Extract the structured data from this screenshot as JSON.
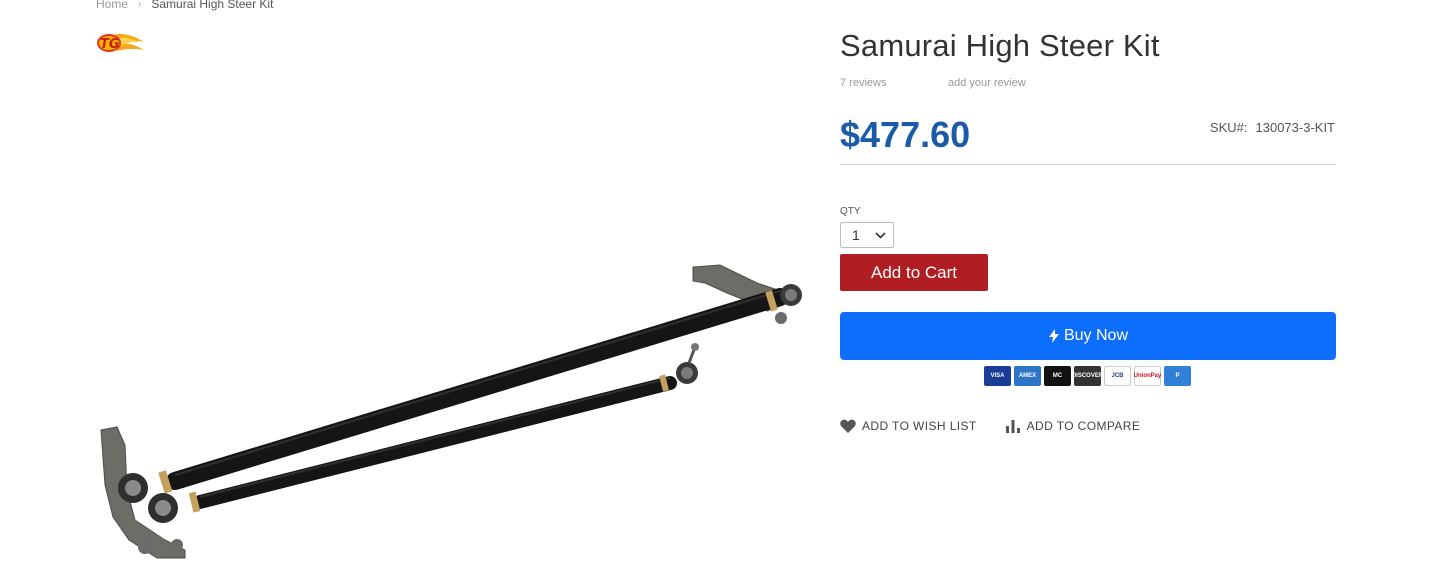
{
  "breadcrumb": {
    "home": "Home",
    "separator": "›",
    "current": "Samurai High Steer Kit"
  },
  "brand": {
    "logo_text": "TG"
  },
  "product": {
    "title": "Samurai High Steer Kit",
    "reviews": "7 reviews",
    "add_review": "add your review",
    "price": "$477.60",
    "sku_label": "SKU#:",
    "sku_value": "130073-3-KIT"
  },
  "purchase": {
    "qty_label": "QTY",
    "qty_value": "1",
    "add_to_cart": "Add to Cart",
    "buy_now": "Buy Now"
  },
  "payment_methods": [
    {
      "name": "VISA",
      "bg": "#1a3c96",
      "fg": "#ffffff"
    },
    {
      "name": "AMEX",
      "bg": "#2b74c8",
      "fg": "#ffffff"
    },
    {
      "name": "MC",
      "bg": "#111111",
      "fg": "#ffffff"
    },
    {
      "name": "DISCOVER",
      "bg": "#333333",
      "fg": "#ffffff"
    },
    {
      "name": "JCB",
      "bg": "#ffffff",
      "fg": "#1a3c96"
    },
    {
      "name": "UnionPay",
      "bg": "#ffffff",
      "fg": "#c8102e"
    },
    {
      "name": "P",
      "bg": "#2f80d6",
      "fg": "#ffffff"
    }
  ],
  "actions": {
    "wish_list": "ADD TO WISH LIST",
    "compare": "ADD TO COMPARE"
  },
  "icons": {
    "buy_now": "bolt-icon",
    "wish_list": "heart-icon",
    "compare": "bar-chart-icon",
    "qty": "chevron-down-icon"
  },
  "colors": {
    "price": "#1a5aa8",
    "add_to_cart": "#b01e23",
    "buy_now": "#0d6efd"
  }
}
